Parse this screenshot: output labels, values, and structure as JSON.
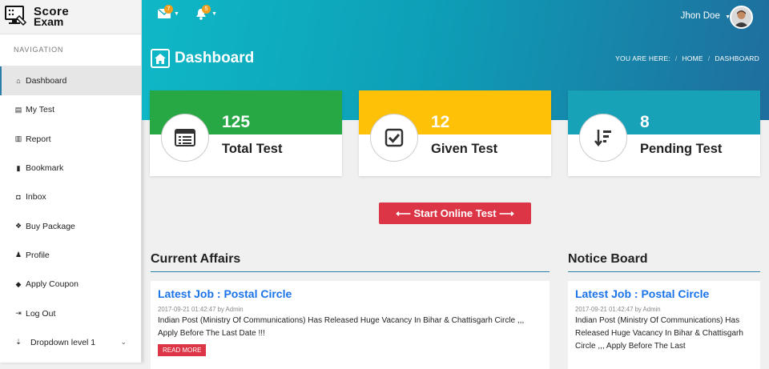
{
  "logo": {
    "line1": "Score",
    "line2": "Exam"
  },
  "nav": {
    "heading": "NAVIGATION",
    "items": [
      {
        "label": "Dashboard",
        "icon": "home-icon",
        "glyph": "⌂"
      },
      {
        "label": "My Test",
        "icon": "list-icon",
        "glyph": "▤"
      },
      {
        "label": "Report",
        "icon": "bar-chart-icon",
        "glyph": "▥"
      },
      {
        "label": "Bookmark",
        "icon": "bookmark-icon",
        "glyph": "▮"
      },
      {
        "label": "Inbox",
        "icon": "inbox-icon",
        "glyph": "◘"
      },
      {
        "label": "Buy Package",
        "icon": "dropbox-icon",
        "glyph": "❖"
      },
      {
        "label": "Profile",
        "icon": "user-icon",
        "glyph": "♟"
      },
      {
        "label": "Apply Coupon",
        "icon": "tag-icon",
        "glyph": "◆"
      },
      {
        "label": "Log Out",
        "icon": "sign-out-icon",
        "glyph": "⇥"
      },
      {
        "label": "Dropdown level 1",
        "icon": "sort-icon",
        "glyph": "⇣",
        "caret": "⌄"
      }
    ]
  },
  "topbar": {
    "mail_count": "7",
    "bell_count": "5",
    "user_name": "Jhon Doe"
  },
  "page": {
    "title": "Dashboard",
    "breadcrumb": {
      "prefix": "YOU ARE HERE:",
      "home": "HOME",
      "current": "DASHBOARD"
    }
  },
  "stats": [
    {
      "value": "125",
      "label": "Total Test",
      "color": "#28a745"
    },
    {
      "value": "12",
      "label": "Given Test",
      "color": "#ffc107"
    },
    {
      "value": "8",
      "label": "Pending Test",
      "color": "#17a2b8"
    }
  ],
  "start_button": "⟵ Start Online Test ⟶",
  "current_affairs": {
    "title": "Current Affairs",
    "post": {
      "headline": "Latest Job : Postal Circle",
      "meta": "2017-09-21 01:42:47 by Admin",
      "text": "Indian Post (Ministry Of Communications) Has Released Huge Vacancy In Bihar & Chattisgarh Circle ,,, Apply Before The Last Date !!!",
      "read_more": "READ MORE"
    }
  },
  "notice_board": {
    "title": "Notice Board",
    "post": {
      "headline": "Latest Job : Postal Circle",
      "meta": "2017-09-21 01:42:47 by Admin",
      "text": "Indian Post (Ministry Of Communications) Has Released Huge Vacancy In Bihar & Chattisgarh Circle ,,, Apply Before The Last"
    }
  }
}
